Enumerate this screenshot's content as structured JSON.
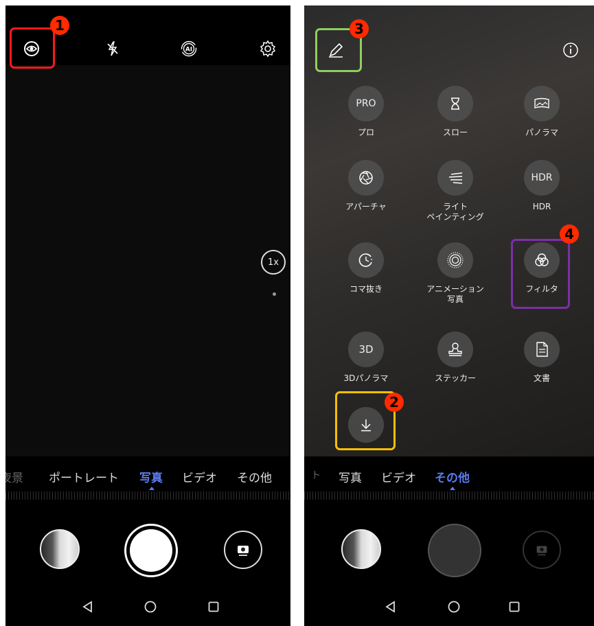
{
  "left": {
    "top_icons": [
      "eye-icon",
      "flash-off-icon",
      "ai-icon",
      "gear-icon"
    ],
    "zoom": "1x",
    "modes": [
      {
        "label": "夜景",
        "state": "faded"
      },
      {
        "label": "ポートレート",
        "state": "normal"
      },
      {
        "label": "写真",
        "state": "active"
      },
      {
        "label": "ビデオ",
        "state": "normal"
      },
      {
        "label": "その他",
        "state": "normal"
      }
    ]
  },
  "right": {
    "top_icons": [
      "edit-pencil-icon",
      "info-icon"
    ],
    "tiles": [
      {
        "icon_text": "PRO",
        "label": "プロ"
      },
      {
        "icon": "hourglass-icon",
        "label": "スロー"
      },
      {
        "icon": "panorama-icon",
        "label": "パノラマ"
      },
      {
        "icon": "aperture-icon",
        "label": "アパーチャ"
      },
      {
        "icon": "light-streak-icon",
        "label": "ライト\nペインティング"
      },
      {
        "icon_text": "HDR",
        "label": "HDR"
      },
      {
        "icon": "timelapse-icon",
        "label": "コマ抜き"
      },
      {
        "icon": "animated-photo-icon",
        "label": "アニメーション\n写真"
      },
      {
        "icon": "filter-icon",
        "label": "フィルタ"
      },
      {
        "icon_text": "3D",
        "label": "3Dパノラマ"
      },
      {
        "icon": "sticker-icon",
        "label": "ステッカー"
      },
      {
        "icon": "document-icon",
        "label": "文書"
      },
      {
        "icon": "download-icon",
        "label": ""
      }
    ],
    "modes": [
      {
        "label": "ト",
        "state": "faded"
      },
      {
        "label": "写真",
        "state": "normal"
      },
      {
        "label": "ビデオ",
        "state": "normal"
      },
      {
        "label": "その他",
        "state": "active"
      }
    ]
  },
  "annotations": [
    {
      "number": "1",
      "color": "#ff1a1a"
    },
    {
      "number": "2",
      "color": "#ffc000"
    },
    {
      "number": "3",
      "color": "#8fcf5f"
    },
    {
      "number": "4",
      "color": "#7b2fa8"
    }
  ],
  "colors": {
    "accent": "#5a7cf0",
    "badge": "#ff2a00"
  }
}
